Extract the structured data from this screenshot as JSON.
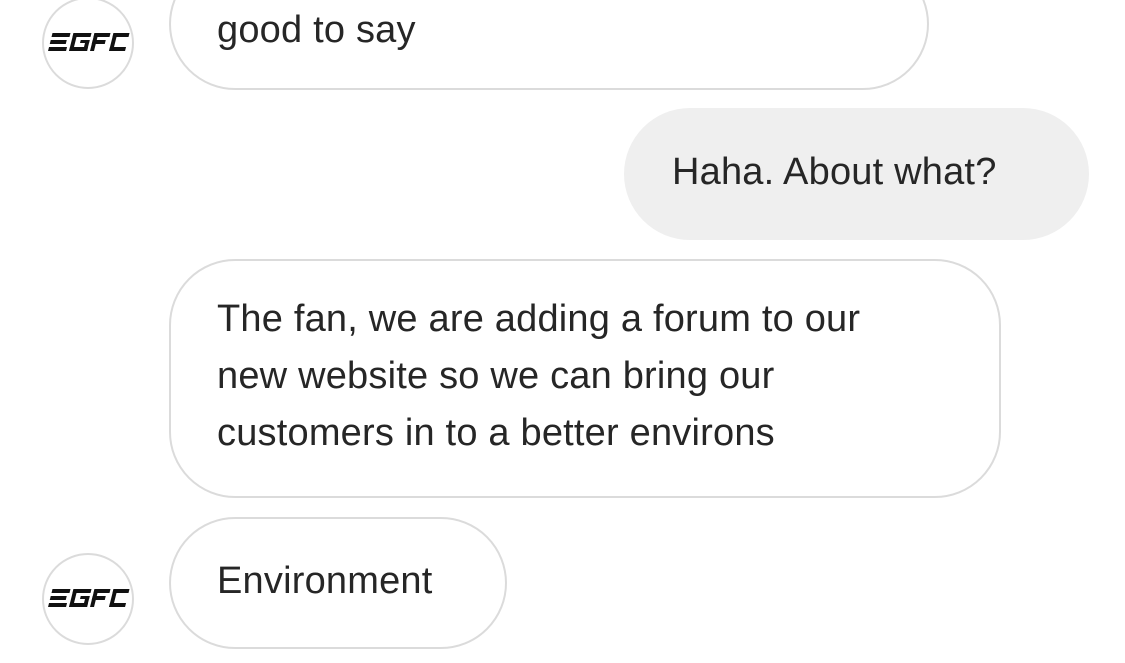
{
  "conversation": {
    "messages": [
      {
        "sender": "other",
        "text": "good to say",
        "avatar": "egfc-logo"
      },
      {
        "sender": "me",
        "text": "Haha. About what?"
      },
      {
        "sender": "other",
        "text": "The fan, we are adding a forum to our\nnew website so we can bring our\ncustomers in to a better environs"
      },
      {
        "sender": "other",
        "text": "Environment",
        "avatar": "egfc-logo"
      }
    ]
  },
  "avatar": {
    "logo_text": "EGFC",
    "icon": "egfc-logo-icon"
  },
  "colors": {
    "incoming_border": "#dbdbdb",
    "outgoing_bg": "#efefef",
    "text": "#262626"
  }
}
